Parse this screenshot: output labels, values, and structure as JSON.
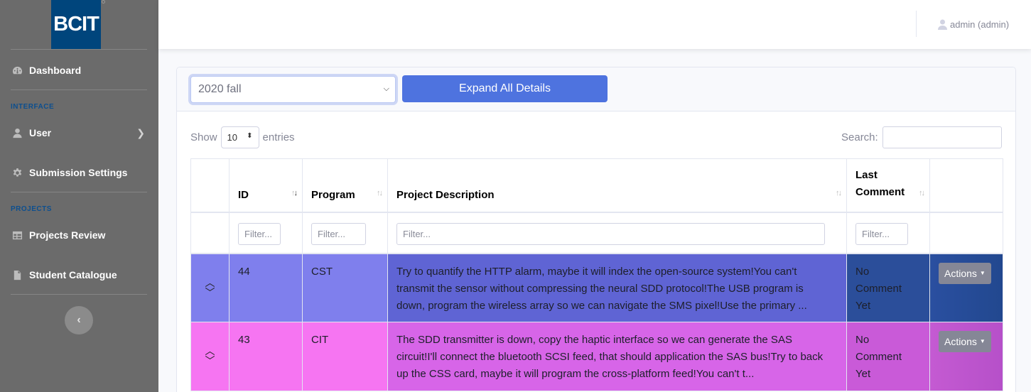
{
  "brand": {
    "logo_text": "BCIT"
  },
  "sidebar": {
    "dashboard": "Dashboard",
    "heading_interface": "INTERFACE",
    "user": "User",
    "submission_settings": "Submission Settings",
    "heading_projects": "PROJECTS",
    "projects_review": "Projects Review",
    "student_catalogue": "Student Catalogue",
    "toggle_icon": "‹"
  },
  "topbar": {
    "user_label": "admin (admin)"
  },
  "controls": {
    "term_select_value": "2020 fall",
    "expand_button": "Expand All Details",
    "show_label": "Show",
    "entries_value": "10",
    "entries_label": "entries",
    "search_label": "Search:"
  },
  "table": {
    "columns": [
      "",
      "ID",
      "Program",
      "Project Description",
      "Last Comment",
      ""
    ],
    "filter_placeholder": "Filter...",
    "rows": [
      {
        "id": "44",
        "program": "CST",
        "description": "Try to quantify the HTTP alarm, maybe it will index the open-source system!You can't transmit the sensor without compressing the neural SDD protocol!The USB program is down, program the wireless array so we can navigate the SMS pixel!Use the primary ...",
        "last_comment": "No Comment Yet",
        "actions": "Actions",
        "row_color": "#7f7fed"
      },
      {
        "id": "43",
        "program": "CIT",
        "description": "The SDD transmitter is down, copy the haptic interface so we can generate the SAS circuit!I'll connect the bluetooth SCSI feed, that should application the SAS bus!Try to back up the CSS card, maybe it will program the cross-platform feed!You can't t...",
        "last_comment": "No Comment Yet",
        "actions": "Actions",
        "row_color": "#f675f2"
      }
    ]
  }
}
